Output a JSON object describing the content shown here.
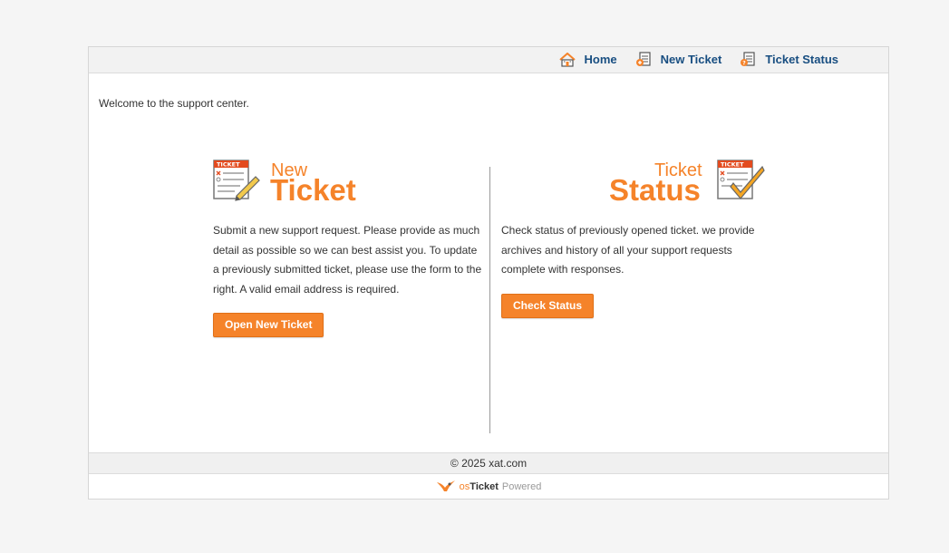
{
  "nav": {
    "home": "Home",
    "new_ticket": "New Ticket",
    "ticket_status": "Ticket Status"
  },
  "welcome": "Welcome to the support center.",
  "new_ticket": {
    "word_small": "New",
    "word_big": "Ticket",
    "description": "Submit a new support request. Please provide as much detail as possible so we can best assist you. To update a previously submitted ticket, please use the form to the right. A valid email address is required.",
    "button": "Open New Ticket",
    "icon_label": "TICKET"
  },
  "ticket_status": {
    "word_small": "Ticket",
    "word_big": "Status",
    "description": "Check status of previously opened ticket. we provide archives and history of all your support requests complete with responses.",
    "button": "Check Status",
    "icon_label": "TICKET"
  },
  "footer": {
    "copyright": "© 2025 xat.com",
    "powered_os": "os",
    "powered_ticket": "Ticket",
    "powered_by": "Powered"
  },
  "colors": {
    "accent": "#f5832a",
    "link": "#184e81"
  }
}
